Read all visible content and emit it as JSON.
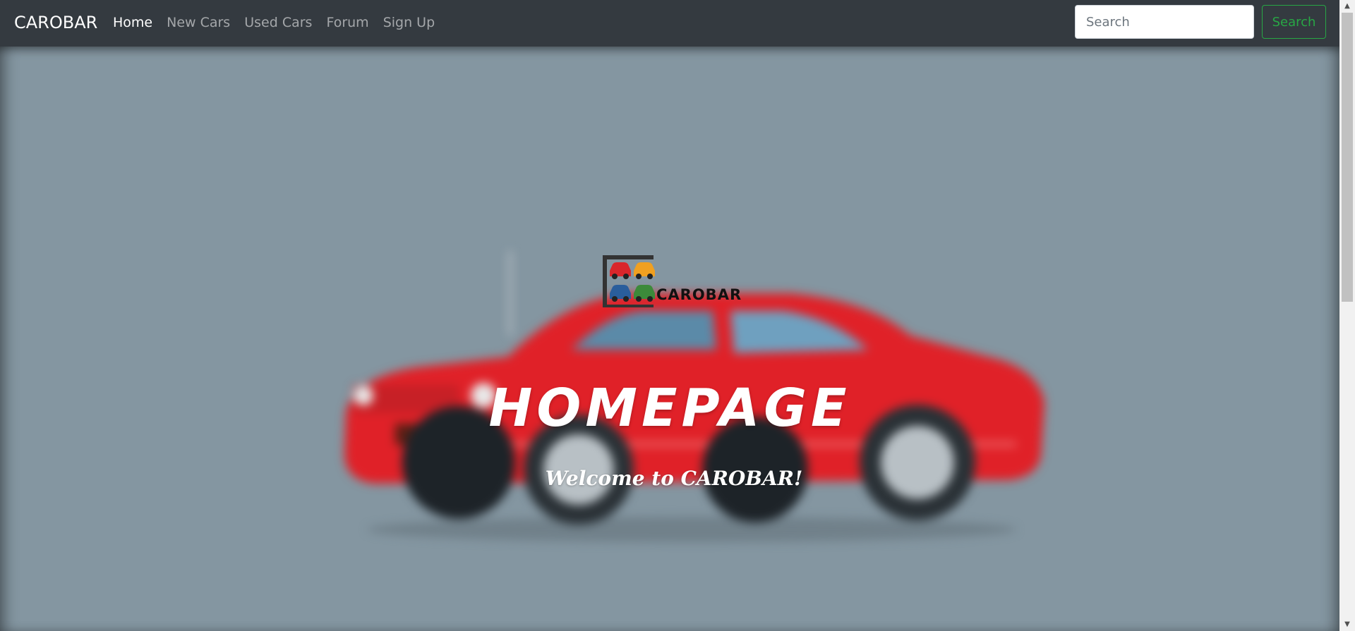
{
  "navbar": {
    "brand": "CAROBAR",
    "links": [
      {
        "label": "Home",
        "active": true
      },
      {
        "label": "New Cars",
        "active": false
      },
      {
        "label": "Used Cars",
        "active": false
      },
      {
        "label": "Forum",
        "active": false
      },
      {
        "label": "Sign Up",
        "active": false
      }
    ],
    "search": {
      "placeholder": "Search",
      "value": "",
      "button_label": "Search"
    }
  },
  "hero": {
    "logo_text": "CAROBAR",
    "title": "HOMEPAGE",
    "subtitle": "Welcome to CAROBAR!",
    "background_icon": "red-car-blurred",
    "logo_icon_colors": [
      "#d9262b",
      "#f0a020",
      "#2a5e9c",
      "#3c8a3a"
    ]
  },
  "colors": {
    "navbar_bg": "#343a40",
    "hero_bg": "#8496a1",
    "search_accent": "#28a745",
    "car_red": "#e02128"
  }
}
